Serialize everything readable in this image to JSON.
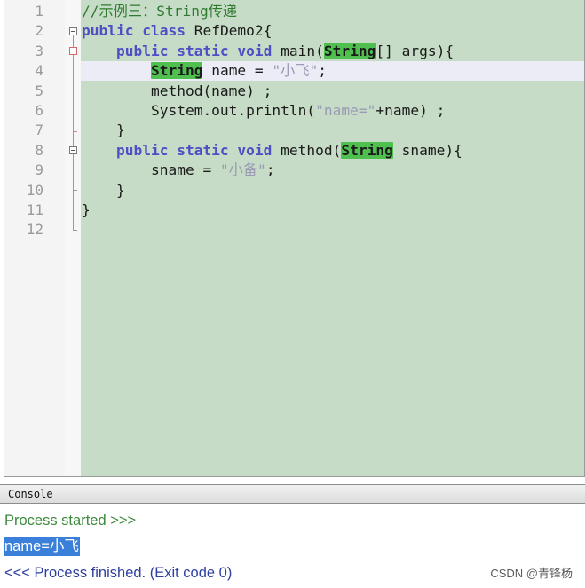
{
  "editor": {
    "line_numbers": [
      "1",
      "2",
      "3",
      "4",
      "5",
      "6",
      "7",
      "8",
      "9",
      "10",
      "11",
      "12"
    ],
    "lines": [
      {
        "segments": [
          {
            "text": "//示例三：String传递",
            "cls": "cm"
          }
        ]
      },
      {
        "segments": [
          {
            "text": "public class ",
            "cls": "kw"
          },
          {
            "text": "RefDemo2{",
            "cls": ""
          }
        ]
      },
      {
        "segments": [
          {
            "text": "    public static void ",
            "cls": "kw"
          },
          {
            "text": "main(",
            "cls": ""
          },
          {
            "text": "String",
            "cls": "hl"
          },
          {
            "text": "[] args){",
            "cls": ""
          }
        ]
      },
      {
        "segments": [
          {
            "text": "        ",
            "cls": ""
          },
          {
            "text": "String",
            "cls": "hl"
          },
          {
            "text": " name = ",
            "cls": ""
          },
          {
            "text": "\"小飞\"",
            "cls": "str"
          },
          {
            "text": ";",
            "cls": ""
          }
        ]
      },
      {
        "segments": [
          {
            "text": "        method(name) ;",
            "cls": ""
          }
        ]
      },
      {
        "segments": [
          {
            "text": "        System.out.println(",
            "cls": ""
          },
          {
            "text": "\"name=\"",
            "cls": "str"
          },
          {
            "text": "+name) ;",
            "cls": ""
          }
        ]
      },
      {
        "segments": [
          {
            "text": "    }",
            "cls": ""
          }
        ]
      },
      {
        "segments": [
          {
            "text": "    public static void ",
            "cls": "kw"
          },
          {
            "text": "method(",
            "cls": ""
          },
          {
            "text": "String",
            "cls": "hl"
          },
          {
            "text": " sname){",
            "cls": ""
          }
        ]
      },
      {
        "segments": [
          {
            "text": "        sname = ",
            "cls": ""
          },
          {
            "text": "\"小备\"",
            "cls": "str"
          },
          {
            "text": ";",
            "cls": ""
          }
        ]
      },
      {
        "segments": [
          {
            "text": "    }",
            "cls": ""
          }
        ]
      },
      {
        "segments": [
          {
            "text": "}",
            "cls": ""
          }
        ]
      },
      {
        "segments": []
      }
    ],
    "current_line": 4
  },
  "console": {
    "tab_label": "Console",
    "started": "Process started >>>",
    "result": "name=小飞",
    "finished": "<<< Process finished. (Exit code 0)"
  },
  "watermark": "CSDN @青锋杨",
  "colors": {
    "editor_bg": "#c6dcc6",
    "keyword": "#4f4fc4",
    "comment": "#2f7a2f",
    "string": "#9b9bb5",
    "type_highlight": "#4fbf4f",
    "selection": "#3a7fd9"
  }
}
